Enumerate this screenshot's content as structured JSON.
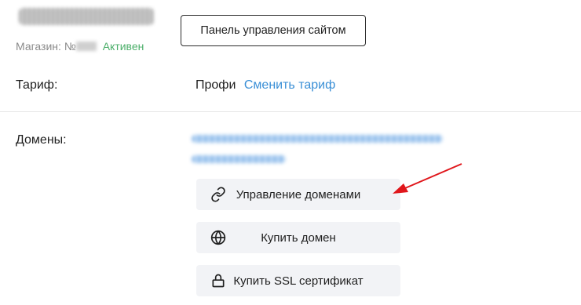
{
  "store": {
    "label": "Магазин: №",
    "status": "Активен"
  },
  "panel_button": "Панель управления сайтом",
  "tariff": {
    "label": "Тариф:",
    "value": "Профи",
    "change_link": "Сменить тариф"
  },
  "domains": {
    "label": "Домены:"
  },
  "buttons": {
    "manage_domains": "Управление доменами",
    "buy_domain": "Купить домен",
    "buy_ssl": "Купить SSL сертификат"
  },
  "icons": {
    "manage_domains": "link-icon",
    "buy_domain": "globe-icon",
    "buy_ssl": "lock-icon"
  },
  "colors": {
    "accent_link": "#3a8fd6",
    "status_active": "#4caf6a",
    "button_bg": "#f2f3f6",
    "annotation_arrow": "#e0161b"
  }
}
